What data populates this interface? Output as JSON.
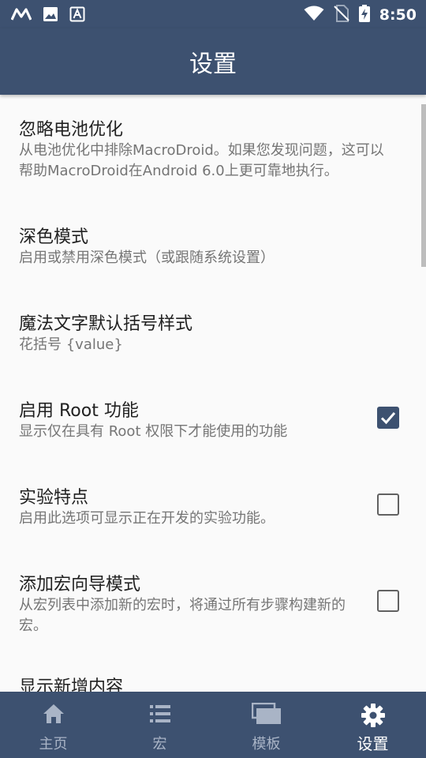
{
  "status_bar": {
    "time": "8:50",
    "left_icons": [
      "macrodroid-icon",
      "image-icon",
      "accessibility-icon"
    ],
    "right_icons": [
      "wifi-icon",
      "no-sim-icon",
      "battery-charging-icon"
    ]
  },
  "app_bar": {
    "title": "设置"
  },
  "settings": [
    {
      "title": "忽略电池优化",
      "description": "从电池优化中排除MacroDroid。如果您发现问题，这可以帮助MacroDroid在Android 6.0上更可靠地执行。"
    },
    {
      "title": "深色模式",
      "description": "启用或禁用深色模式（或跟随系统设置）"
    },
    {
      "title": "魔法文字默认括号样式",
      "description": "花括号 {value}"
    },
    {
      "title": "启用 Root 功能",
      "description": "显示仅在具有 Root 权限下才能使用的功能",
      "checked": true
    },
    {
      "title": "实验特点",
      "description": "启用此选项可显示正在开发的实验功能。",
      "checked": false
    },
    {
      "title": "添加宏向导模式",
      "description": "从宏列表中添加新的宏时，将通过所有步骤构建新的宏。",
      "checked": false
    },
    {
      "title": "显示新增内容"
    }
  ],
  "bottom_nav": [
    {
      "label": "主页",
      "icon": "home-icon",
      "active": false
    },
    {
      "label": "宏",
      "icon": "list-icon",
      "active": false
    },
    {
      "label": "模板",
      "icon": "templates-icon",
      "active": false
    },
    {
      "label": "设置",
      "icon": "gear-icon",
      "active": true
    }
  ],
  "colors": {
    "primary": "#3d5170",
    "background": "#fafafa",
    "title_text": "#212121",
    "desc_text": "#757575"
  }
}
